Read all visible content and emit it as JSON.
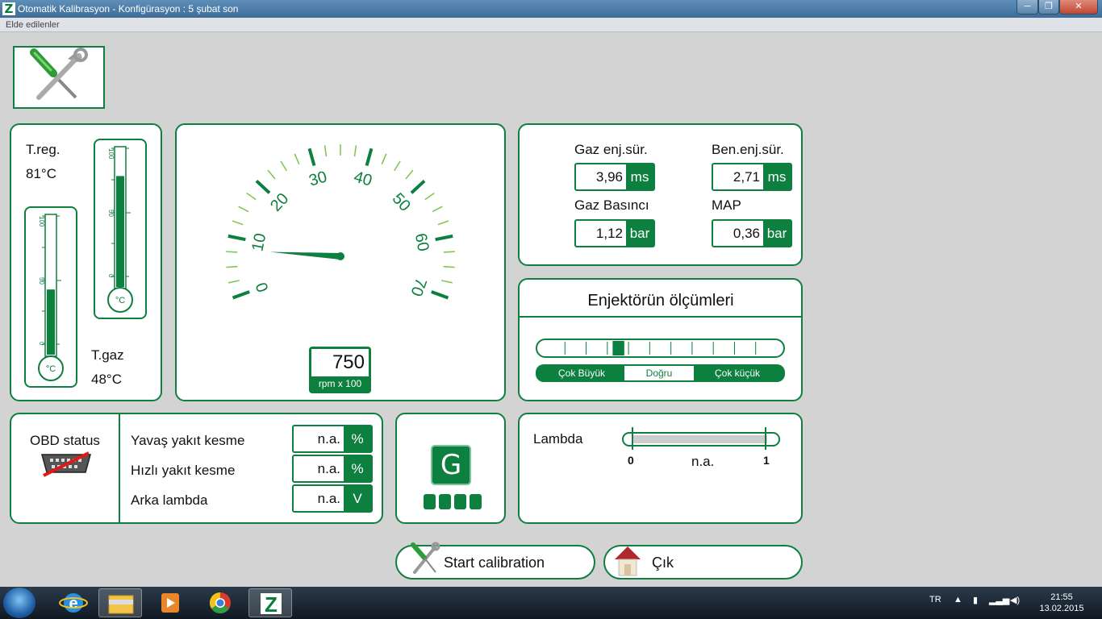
{
  "window": {
    "title": "Otomatik Kalibrasyon - Konfigürasyon : 5 şubat son",
    "app_icon_letter": "Z",
    "min": "─",
    "max": "❐",
    "close": "✕"
  },
  "menu": {
    "item": "Elde edilenler"
  },
  "temps": {
    "reg_label": "T.reg.",
    "reg_value": "81°C",
    "reg_level": 80,
    "gas_label": "T.gaz",
    "gas_value": "48°C",
    "gas_level": 47,
    "scale_ticks": [
      "100",
      "50",
      "0"
    ],
    "bulb_label": "°C"
  },
  "gauge": {
    "ticks": [
      "0",
      "10",
      "20",
      "30",
      "40",
      "50",
      "60",
      "70"
    ],
    "rpm_value": "750",
    "rpm_unit": "rpm x 100",
    "needle_value": 7.5
  },
  "readings": [
    {
      "label": "Gaz enj.sür.",
      "value": "3,96",
      "unit": "ms"
    },
    {
      "label": "Ben.enj.sür.",
      "value": "2,71",
      "unit": "ms"
    },
    {
      "label": "Gaz Basıncı",
      "value": "1,12",
      "unit": "bar"
    },
    {
      "label": "MAP",
      "value": "0,36",
      "unit": "bar"
    }
  ],
  "injector": {
    "title": "Enjektörün ölçümleri",
    "labels": [
      "Çok Büyük",
      "Doğru",
      "Çok küçük"
    ],
    "position_index": 4,
    "segments": 11
  },
  "obd": {
    "label": "OBD status",
    "rows": [
      {
        "label": "Yavaş yakıt kesme",
        "value": "n.a.",
        "unit": "%"
      },
      {
        "label": "Hızlı yakıt kesme",
        "value": "n.a.",
        "unit": "%"
      },
      {
        "label": "Arka lambda",
        "value": "n.a.",
        "unit": "V"
      }
    ]
  },
  "fuel": {
    "letter": "G"
  },
  "lambda": {
    "label": "Lambda",
    "min": "0",
    "max": "1",
    "value": "n.a."
  },
  "buttons": {
    "calibrate": "Start calibration",
    "exit": "Çık"
  },
  "taskbar": {
    "lang": "TR",
    "time": "21:55",
    "date": "13.02.2015"
  },
  "colors": {
    "accent": "#0d7f3f",
    "background": "#d3d3d3"
  }
}
